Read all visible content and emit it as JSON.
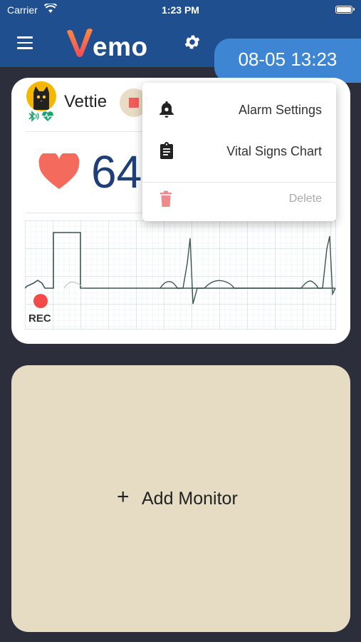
{
  "status_bar": {
    "carrier": "Carrier",
    "time": "1:23 PM"
  },
  "nav": {
    "logo_letter": "V",
    "logo_rest": "emo",
    "datetime": "08-05 13:23"
  },
  "monitor": {
    "pet_name": "Vettie",
    "heart_rate": "64",
    "rec_label": "REC"
  },
  "menu": {
    "items": [
      {
        "label": "Alarm Settings",
        "icon": "bell-icon",
        "enabled": true
      },
      {
        "label": "Vital Signs Chart",
        "icon": "clipboard-icon",
        "enabled": true
      },
      {
        "label": "Delete",
        "icon": "trash-icon",
        "enabled": false
      }
    ]
  },
  "add_monitor": {
    "plus": "+",
    "label": "Add Monitor"
  },
  "colors": {
    "navbar": "#1f4f8f",
    "datebox": "#3e86d4",
    "accent_red": "#f45b5b",
    "hr_value": "#1e3f7a",
    "add_card": "#e6dcc3"
  }
}
